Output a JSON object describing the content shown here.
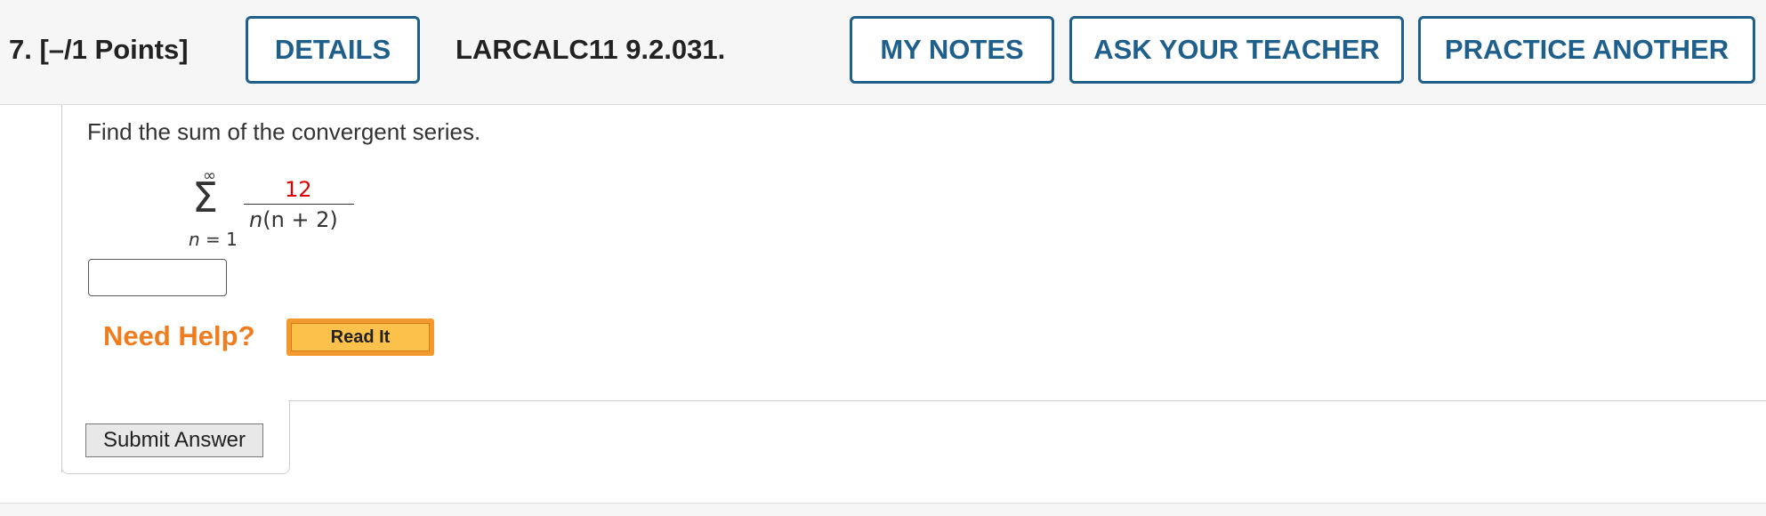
{
  "header": {
    "question_number": "7.",
    "points": "[–/1 Points]",
    "details_label": "DETAILS",
    "question_ref": "LARCALC11 9.2.031.",
    "my_notes_label": "MY NOTES",
    "ask_teacher_label": "ASK YOUR TEACHER",
    "practice_another_label": "PRACTICE ANOTHER"
  },
  "problem": {
    "prompt": "Find the sum of the convergent series.",
    "upper_limit": "∞",
    "sigma": "Σ",
    "index_var": "n",
    "lower_limit_rest": " = 1",
    "numerator": "12",
    "denominator_var": "n",
    "denominator_rest": "(n + 2)"
  },
  "answer": {
    "value": ""
  },
  "help": {
    "need_help_label": "Need Help?",
    "read_it_label": "Read It"
  },
  "submit_label": "Submit Answer",
  "colors": {
    "accent": "#1f5f8b",
    "numerator": "#e00000",
    "need_help": "#f07c1e",
    "read_it": "#fcc14a"
  }
}
